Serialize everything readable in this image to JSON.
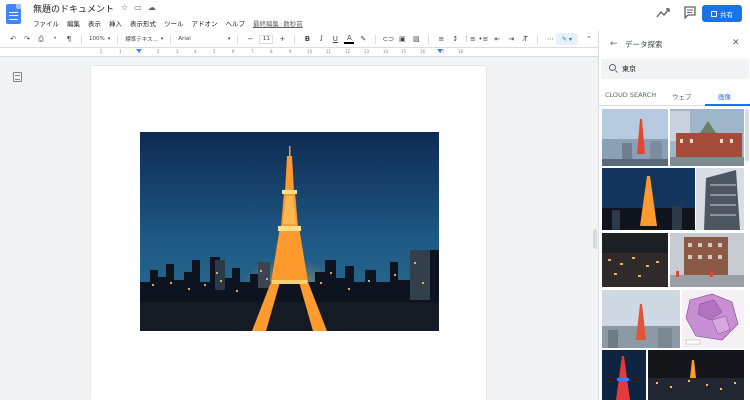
{
  "header": {
    "doc_title": "無題のドキュメント",
    "menu": [
      "ファイル",
      "編集",
      "表示",
      "挿入",
      "表示形式",
      "ツール",
      "アドオン",
      "ヘルプ"
    ],
    "last_edit": "最終編集: 数秒前",
    "share_label": "共有",
    "icons": [
      "star-icon",
      "folder-icon",
      "cloud-icon",
      "trend-icon",
      "comment-icon",
      "lock-icon"
    ]
  },
  "toolbar": {
    "zoom": "100%",
    "style": "標準テキス...",
    "font": "Arial",
    "font_size": "11",
    "bold": "B",
    "italic": "I",
    "underline": "U",
    "text_color": "A",
    "more": "⋯",
    "ruler_ticks": [
      "2",
      "1",
      "1",
      "2",
      "3",
      "4",
      "5",
      "6",
      "7",
      "8",
      "9",
      "10",
      "11",
      "12",
      "13",
      "14",
      "15",
      "16",
      "17",
      "18"
    ]
  },
  "explore": {
    "title": "データ探索",
    "search_value": "東京",
    "tabs": [
      "CLOUD SEARCH",
      "ウェブ",
      "画像"
    ],
    "active_tab": 2
  },
  "colors": {
    "accent": "#1a73e8",
    "doc_blue": "#4285f4"
  }
}
